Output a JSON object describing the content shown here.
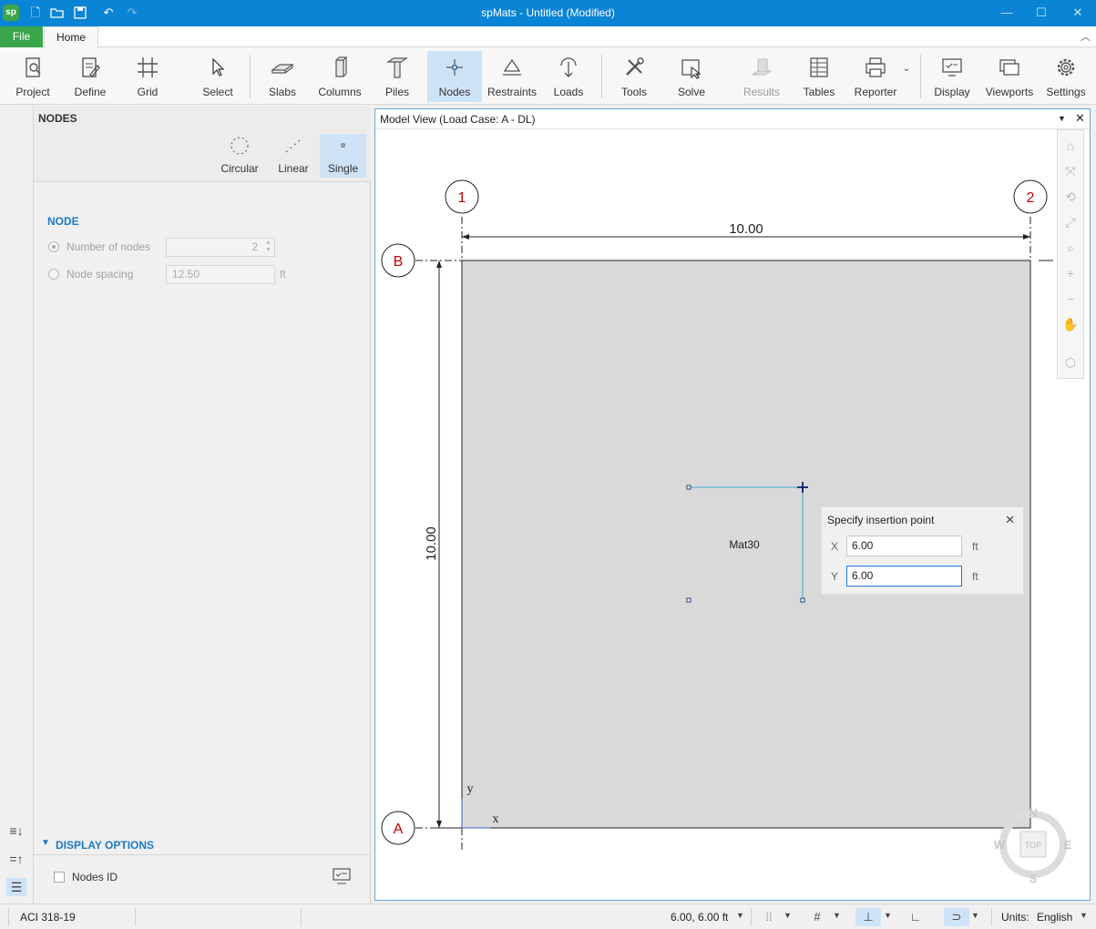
{
  "window": {
    "title": "spMats - Untitled (Modified)",
    "app_icon_text": "sp"
  },
  "menu": {
    "file_label": "File",
    "home_label": "Home"
  },
  "ribbon": {
    "project": "Project",
    "define": "Define",
    "grid": "Grid",
    "select": "Select",
    "slabs": "Slabs",
    "columns": "Columns",
    "piles": "Piles",
    "nodes": "Nodes",
    "restraints": "Restraints",
    "loads": "Loads",
    "tools": "Tools",
    "solve": "Solve",
    "results": "Results",
    "tables": "Tables",
    "reporter": "Reporter",
    "display": "Display",
    "viewports": "Viewports",
    "settings": "Settings"
  },
  "panel": {
    "title": "NODES",
    "modes": {
      "circular": "Circular",
      "linear": "Linear",
      "single": "Single"
    },
    "section": "NODE",
    "number_of_nodes_label": "Number of nodes",
    "number_of_nodes_value": "2",
    "node_spacing_label": "Node spacing",
    "node_spacing_value": "12.50",
    "node_spacing_unit": "ft",
    "display_options": "DISPLAY OPTIONS",
    "nodes_id_label": "Nodes ID"
  },
  "viewport": {
    "title": "Model View (Load Case: A - DL)",
    "grid_labels": {
      "c1": "1",
      "c2": "2",
      "rb": "B",
      "ra": "A"
    },
    "dim_horizontal": "10.00",
    "dim_vertical": "10.00",
    "slab_label": "Mat30",
    "axis_x": "x",
    "axis_y": "y",
    "compass": {
      "n": "N",
      "s": "S",
      "e": "E",
      "w": "W",
      "top": "TOP"
    }
  },
  "popup": {
    "title": "Specify insertion point",
    "x_label": "X",
    "x_value": "6.00",
    "x_unit": "ft",
    "y_label": "Y",
    "y_value": "6.00",
    "y_unit": "ft"
  },
  "status": {
    "code": "ACI 318-19",
    "coords": "6.00, 6.00 ft",
    "units_label": "Units:",
    "units_value": "English"
  },
  "colors": {
    "titlebar": "#0a84d4",
    "file_tab": "#3aa64a",
    "accent": "#1e7ac6",
    "slab_fill": "#d9d9d9",
    "grid_label": "#c00000"
  }
}
